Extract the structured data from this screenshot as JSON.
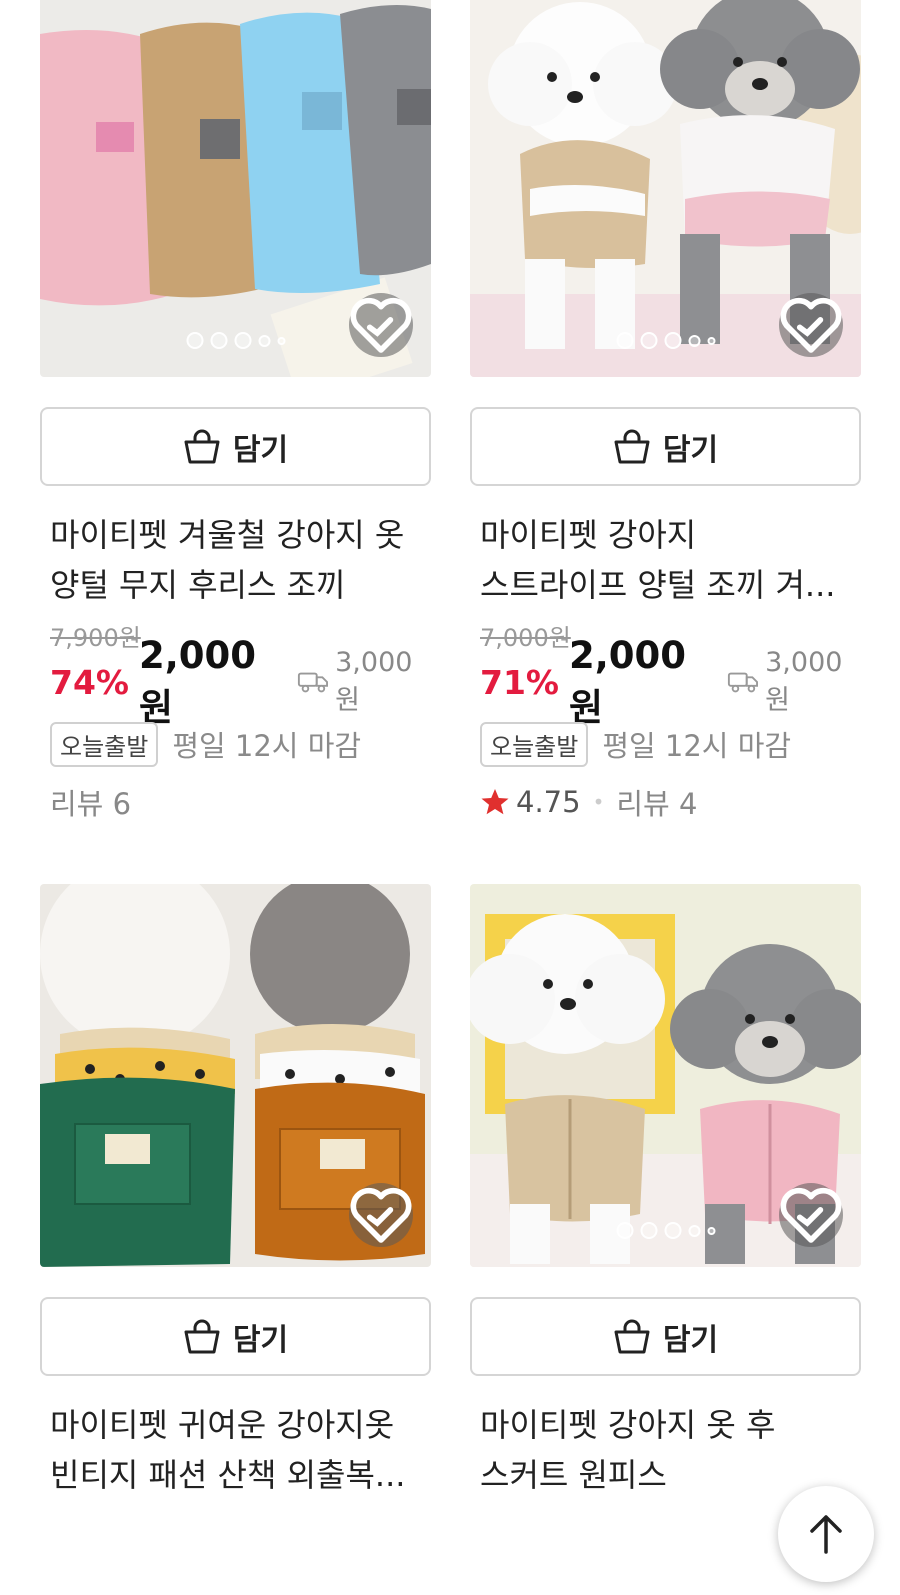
{
  "products": [
    {
      "title_line1": "마이티펫 겨울철 강아지 옷",
      "title_line2": "양털 무지 후리스 조끼",
      "original_price": "7,900원",
      "discount": "74%",
      "price": "2,000원",
      "shipping": "3,000원",
      "badge": "오늘출발",
      "deadline": "평일 12시 마감",
      "review": "리뷰 6",
      "cart_label": "담기",
      "image_dot_count": 5,
      "image_dot_active_index": 0
    },
    {
      "title_line1": "마이티펫 강아지",
      "title_line2": "스트라이프 양털 조끼 겨...",
      "original_price": "7,000원",
      "discount": "71%",
      "price": "2,000원",
      "shipping": "3,000원",
      "badge": "오늘출발",
      "deadline": "평일 12시 마감",
      "rating": "4.75",
      "review": "리뷰 4",
      "cart_label": "담기",
      "image_dot_count": 5,
      "image_dot_active_index": 0
    },
    {
      "title_line1": "마이티펫 귀여운 강아지옷",
      "title_line2": "빈티지 패션 산책 외출복...",
      "cart_label": "담기"
    },
    {
      "title_line1": "마이티펫 강아지 옷 후",
      "title_line2": "스커트 원피스",
      "cart_label": "담기",
      "image_dot_count": 5,
      "image_dot_active_index": 0
    }
  ],
  "colors": {
    "discount_red": "#e31b3f",
    "star": "#e0302e",
    "badge_border": "#d0d0d0"
  },
  "icons": {
    "cart": "shopping-bag-icon",
    "wish": "heart-icon",
    "shipping": "truck-icon",
    "scroll_top": "arrow-up-icon",
    "rating": "star-icon"
  }
}
